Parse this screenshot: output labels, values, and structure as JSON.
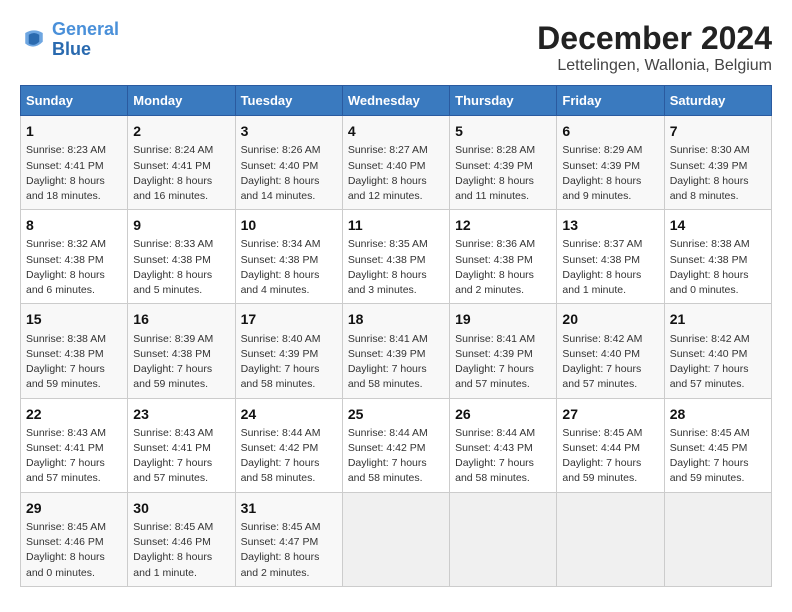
{
  "header": {
    "logo_line1": "General",
    "logo_line2": "Blue",
    "title": "December 2024",
    "subtitle": "Lettelingen, Wallonia, Belgium"
  },
  "weekdays": [
    "Sunday",
    "Monday",
    "Tuesday",
    "Wednesday",
    "Thursday",
    "Friday",
    "Saturday"
  ],
  "weeks": [
    [
      {
        "day": "1",
        "info": "Sunrise: 8:23 AM\nSunset: 4:41 PM\nDaylight: 8 hours and 18 minutes."
      },
      {
        "day": "2",
        "info": "Sunrise: 8:24 AM\nSunset: 4:41 PM\nDaylight: 8 hours and 16 minutes."
      },
      {
        "day": "3",
        "info": "Sunrise: 8:26 AM\nSunset: 4:40 PM\nDaylight: 8 hours and 14 minutes."
      },
      {
        "day": "4",
        "info": "Sunrise: 8:27 AM\nSunset: 4:40 PM\nDaylight: 8 hours and 12 minutes."
      },
      {
        "day": "5",
        "info": "Sunrise: 8:28 AM\nSunset: 4:39 PM\nDaylight: 8 hours and 11 minutes."
      },
      {
        "day": "6",
        "info": "Sunrise: 8:29 AM\nSunset: 4:39 PM\nDaylight: 8 hours and 9 minutes."
      },
      {
        "day": "7",
        "info": "Sunrise: 8:30 AM\nSunset: 4:39 PM\nDaylight: 8 hours and 8 minutes."
      }
    ],
    [
      {
        "day": "8",
        "info": "Sunrise: 8:32 AM\nSunset: 4:38 PM\nDaylight: 8 hours and 6 minutes."
      },
      {
        "day": "9",
        "info": "Sunrise: 8:33 AM\nSunset: 4:38 PM\nDaylight: 8 hours and 5 minutes."
      },
      {
        "day": "10",
        "info": "Sunrise: 8:34 AM\nSunset: 4:38 PM\nDaylight: 8 hours and 4 minutes."
      },
      {
        "day": "11",
        "info": "Sunrise: 8:35 AM\nSunset: 4:38 PM\nDaylight: 8 hours and 3 minutes."
      },
      {
        "day": "12",
        "info": "Sunrise: 8:36 AM\nSunset: 4:38 PM\nDaylight: 8 hours and 2 minutes."
      },
      {
        "day": "13",
        "info": "Sunrise: 8:37 AM\nSunset: 4:38 PM\nDaylight: 8 hours and 1 minute."
      },
      {
        "day": "14",
        "info": "Sunrise: 8:38 AM\nSunset: 4:38 PM\nDaylight: 8 hours and 0 minutes."
      }
    ],
    [
      {
        "day": "15",
        "info": "Sunrise: 8:38 AM\nSunset: 4:38 PM\nDaylight: 7 hours and 59 minutes."
      },
      {
        "day": "16",
        "info": "Sunrise: 8:39 AM\nSunset: 4:38 PM\nDaylight: 7 hours and 59 minutes."
      },
      {
        "day": "17",
        "info": "Sunrise: 8:40 AM\nSunset: 4:39 PM\nDaylight: 7 hours and 58 minutes."
      },
      {
        "day": "18",
        "info": "Sunrise: 8:41 AM\nSunset: 4:39 PM\nDaylight: 7 hours and 58 minutes."
      },
      {
        "day": "19",
        "info": "Sunrise: 8:41 AM\nSunset: 4:39 PM\nDaylight: 7 hours and 57 minutes."
      },
      {
        "day": "20",
        "info": "Sunrise: 8:42 AM\nSunset: 4:40 PM\nDaylight: 7 hours and 57 minutes."
      },
      {
        "day": "21",
        "info": "Sunrise: 8:42 AM\nSunset: 4:40 PM\nDaylight: 7 hours and 57 minutes."
      }
    ],
    [
      {
        "day": "22",
        "info": "Sunrise: 8:43 AM\nSunset: 4:41 PM\nDaylight: 7 hours and 57 minutes."
      },
      {
        "day": "23",
        "info": "Sunrise: 8:43 AM\nSunset: 4:41 PM\nDaylight: 7 hours and 57 minutes."
      },
      {
        "day": "24",
        "info": "Sunrise: 8:44 AM\nSunset: 4:42 PM\nDaylight: 7 hours and 58 minutes."
      },
      {
        "day": "25",
        "info": "Sunrise: 8:44 AM\nSunset: 4:42 PM\nDaylight: 7 hours and 58 minutes."
      },
      {
        "day": "26",
        "info": "Sunrise: 8:44 AM\nSunset: 4:43 PM\nDaylight: 7 hours and 58 minutes."
      },
      {
        "day": "27",
        "info": "Sunrise: 8:45 AM\nSunset: 4:44 PM\nDaylight: 7 hours and 59 minutes."
      },
      {
        "day": "28",
        "info": "Sunrise: 8:45 AM\nSunset: 4:45 PM\nDaylight: 7 hours and 59 minutes."
      }
    ],
    [
      {
        "day": "29",
        "info": "Sunrise: 8:45 AM\nSunset: 4:46 PM\nDaylight: 8 hours and 0 minutes."
      },
      {
        "day": "30",
        "info": "Sunrise: 8:45 AM\nSunset: 4:46 PM\nDaylight: 8 hours and 1 minute."
      },
      {
        "day": "31",
        "info": "Sunrise: 8:45 AM\nSunset: 4:47 PM\nDaylight: 8 hours and 2 minutes."
      },
      null,
      null,
      null,
      null
    ]
  ]
}
